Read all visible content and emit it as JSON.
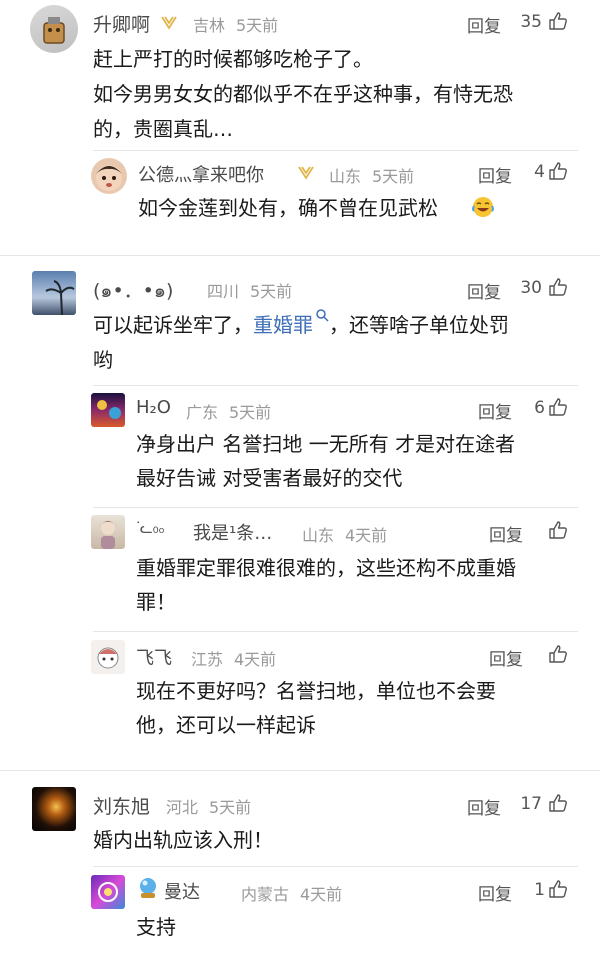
{
  "comments": [
    {
      "user": "升卿啊",
      "location": "吉林",
      "time": "5天前",
      "reply_label": "回复",
      "likes": "35",
      "lines": [
        "赶上严打的时候都够吃枪子了。",
        "如今男男女女的都似乎不在乎这种事，有恃无恐",
        "的，贵圈真乱…"
      ],
      "replies": [
        {
          "user": "公德灬拿来吧你",
          "location": "山东",
          "time": "5天前",
          "reply_label": "回复",
          "likes": "4",
          "lines": [
            "如今金莲到处有，确不曾在见武松"
          ]
        }
      ]
    },
    {
      "user": "(๑•．•๑)",
      "location": "四川",
      "time": "5天前",
      "reply_label": "回复",
      "likes": "30",
      "line1_before": "可以起诉坐牢了，",
      "line1_link": "重婚罪",
      "line1_after": "，还等啥子单位处罚",
      "line2": "哟",
      "replies": [
        {
          "user": "H₂O",
          "location": "广东",
          "time": "5天前",
          "reply_label": "回复",
          "likes": "6",
          "lines": [
            "净身出户 名誉扫地 一无所有 才是对在途者",
            "最好告诫 对受害者最好的交代"
          ]
        },
        {
          "user": "我是¹条…",
          "location": "山东",
          "time": "4天前",
          "reply_label": "回复",
          "likes": "",
          "lines": [
            "重婚罪定罪很难很难的，这些还构不成重婚",
            "罪！"
          ]
        },
        {
          "user": "飞飞",
          "location": "江苏",
          "time": "4天前",
          "reply_label": "回复",
          "likes": "",
          "lines": [
            "现在不更好吗？名誉扫地，单位也不会要",
            "他，还可以一样起诉"
          ]
        }
      ]
    },
    {
      "user": "刘东旭",
      "location": "河北",
      "time": "5天前",
      "reply_label": "回复",
      "likes": "17",
      "lines": [
        "婚内出轨应该入刑！"
      ],
      "replies": [
        {
          "user": "曼达",
          "location": "内蒙古",
          "time": "4天前",
          "reply_label": "回复",
          "likes": "1",
          "lines": [
            "支持"
          ]
        }
      ]
    }
  ],
  "colors": {
    "link": "#3e6fb8",
    "meta": "#9a9a9a",
    "divider": "#e6e6e6",
    "badge": "#e0b64b"
  },
  "icons": {
    "like": "thumbs-up-icon",
    "search": "search-icon",
    "badge": "vip-badge-icon",
    "emoji": "laughing-crying-emoji-icon"
  }
}
